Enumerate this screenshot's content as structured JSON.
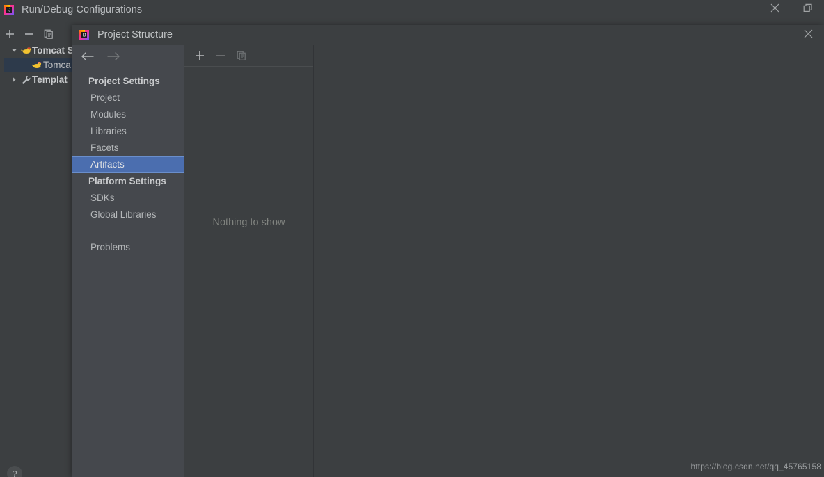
{
  "run_debug_window": {
    "title": "Run/Debug Configurations",
    "app_icon": "intellij-idea-icon",
    "window_buttons": {
      "close": "close-icon",
      "restore": "restore-icon"
    },
    "toolbar": [
      {
        "name": "add-configuration-button",
        "icon": "plus-icon",
        "enabled": true
      },
      {
        "name": "remove-configuration-button",
        "icon": "minus-icon",
        "enabled": true
      },
      {
        "name": "copy-configuration-button",
        "icon": "copy-icon",
        "enabled": true
      }
    ],
    "tree": [
      {
        "label": "Tomcat S",
        "icon": "tomcat-icon",
        "twisty": "expanded",
        "bold": true,
        "selected": false,
        "indent": false
      },
      {
        "label": "Tomca",
        "icon": "tomcat-icon",
        "twisty": "none",
        "bold": false,
        "selected": true,
        "indent": true
      },
      {
        "label": "Templat",
        "icon": "wrench-icon",
        "twisty": "collapsed",
        "bold": true,
        "selected": false,
        "indent": false
      }
    ],
    "help_label": "?"
  },
  "project_structure_dialog": {
    "title": "Project Structure",
    "app_icon": "intellij-idea-icon",
    "close_icon": "close-icon",
    "nav": {
      "back": "arrow-left-icon",
      "forward": "arrow-right-icon"
    },
    "sidebar": [
      {
        "type": "group",
        "label": "Project Settings"
      },
      {
        "type": "item",
        "label": "Project",
        "selected": false
      },
      {
        "type": "item",
        "label": "Modules",
        "selected": false
      },
      {
        "type": "item",
        "label": "Libraries",
        "selected": false
      },
      {
        "type": "item",
        "label": "Facets",
        "selected": false
      },
      {
        "type": "item",
        "label": "Artifacts",
        "selected": true
      },
      {
        "type": "group",
        "label": "Platform Settings"
      },
      {
        "type": "item",
        "label": "SDKs",
        "selected": false
      },
      {
        "type": "item",
        "label": "Global Libraries",
        "selected": false
      },
      {
        "type": "divider"
      },
      {
        "type": "item",
        "label": "Problems",
        "selected": false
      }
    ],
    "detail_toolbar": [
      {
        "name": "add-artifact-button",
        "icon": "plus-icon",
        "enabled": true
      },
      {
        "name": "remove-artifact-button",
        "icon": "minus-icon",
        "enabled": false
      },
      {
        "name": "copy-artifact-button",
        "icon": "copy-icon",
        "enabled": false
      }
    ],
    "empty_state": "Nothing to show"
  },
  "watermark": "https://blog.csdn.net/qq_45765158",
  "colors": {
    "window_bg": "#3c3f41",
    "sidebar_bg": "#45484d",
    "selection_blue": "#4b6eaf",
    "tree_selection": "#2d3a4b",
    "text_primary": "#bbbdbf",
    "text_muted": "#80837f"
  }
}
